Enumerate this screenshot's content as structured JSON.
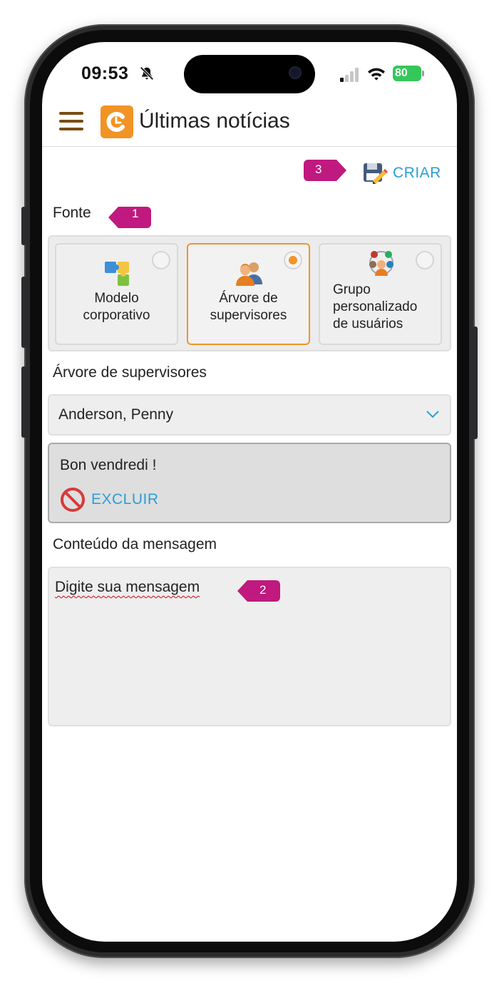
{
  "status_bar": {
    "time": "09:53",
    "battery": "80"
  },
  "header": {
    "title": "Últimas notícias"
  },
  "actions": {
    "create_label": "CRIAR"
  },
  "source": {
    "label": "Fonte",
    "options": [
      {
        "label": "Modelo corporativo",
        "selected": false
      },
      {
        "label": "Árvore de supervisores",
        "selected": true
      },
      {
        "label": "Grupo personalizado de usuários",
        "selected": false
      }
    ]
  },
  "supervisor_tree": {
    "label": "Árvore de supervisores",
    "selected_value": "Anderson, Penny"
  },
  "message_card": {
    "title": "Bon vendredi !",
    "delete_label": "EXCLUIR"
  },
  "message_content": {
    "label": "Conteúdo da mensagem",
    "placeholder": "Digite sua mensagem"
  },
  "callouts": [
    "1",
    "2",
    "3"
  ],
  "colors": {
    "accent_orange": "#f29325",
    "link_blue": "#2a9fd6",
    "callout_magenta": "#c0197f",
    "battery_green": "#34c759"
  }
}
